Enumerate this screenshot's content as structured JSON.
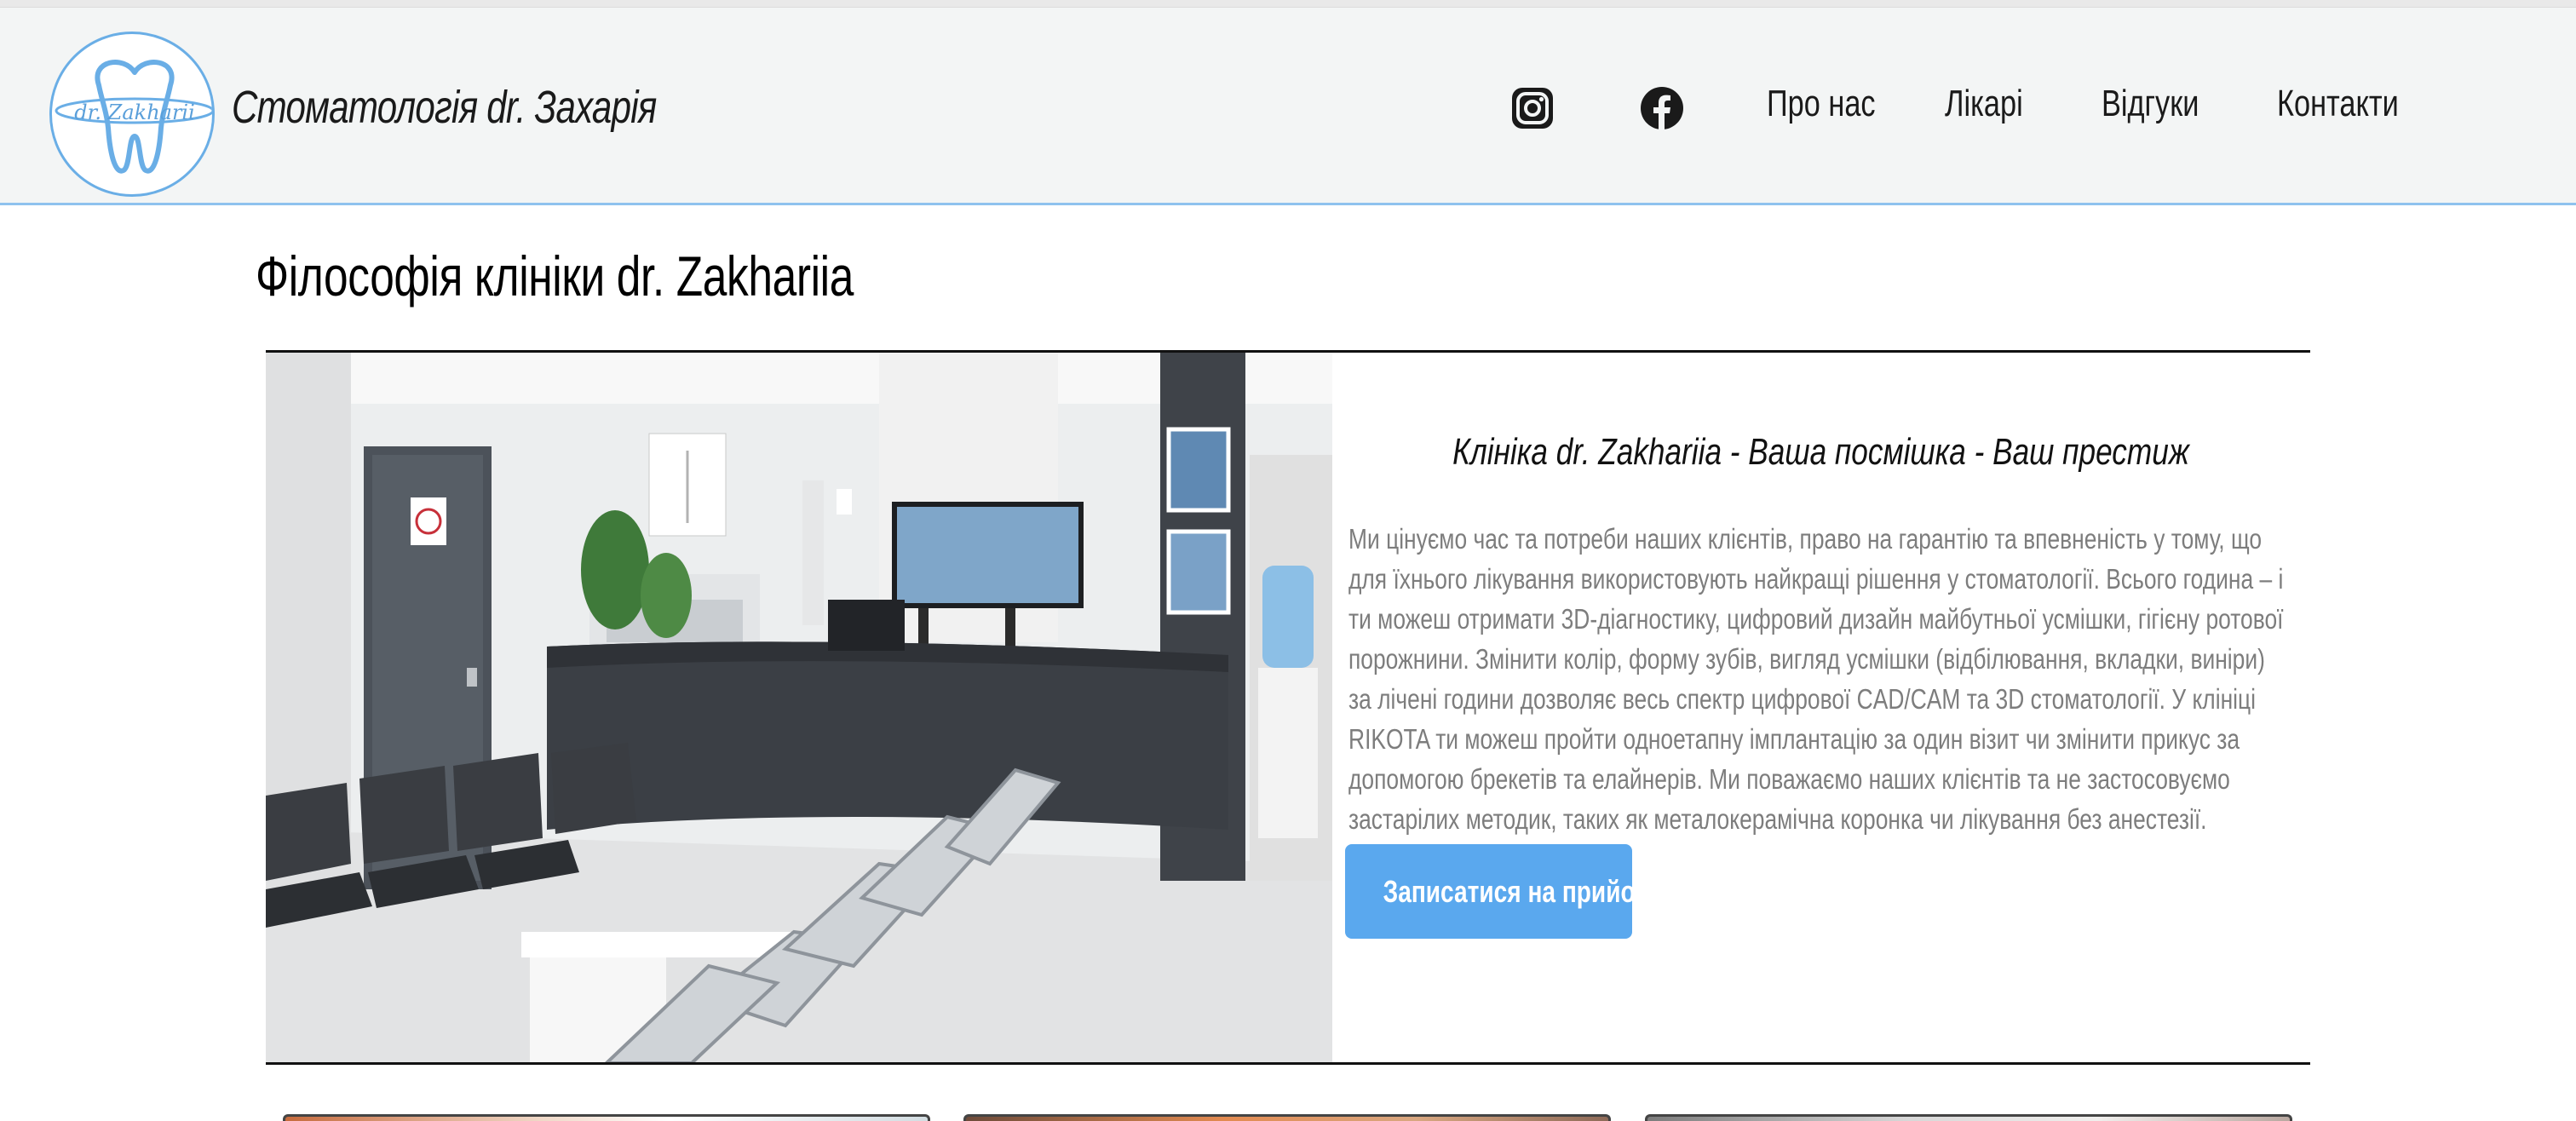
{
  "header": {
    "brand_name": "Стоматологія dr. Захарія",
    "logo_text": "dr. Zakharii",
    "social": [
      {
        "name": "instagram-icon"
      },
      {
        "name": "facebook-icon"
      }
    ],
    "nav": [
      {
        "label": "Про нас"
      },
      {
        "label": "Лікарі"
      },
      {
        "label": "Відгуки"
      },
      {
        "label": "Контакти"
      }
    ]
  },
  "main": {
    "section_title": "Філософія клініки dr. Zakhariia",
    "subtitle": "Клініка dr. Zakhariia - Ваша посмішка - Ваш престиж",
    "paragraph": "Ми цінуємо час та потреби наших клієнтів, право на гарантію та впевненість у тому, що для їхнього лікування використовують найкращі рішення у стоматології. Всього година – і ти можеш отримати 3D-діагностику, цифровий дизайн майбутньої усмішки, гігієну ротової порожнини. Змінити колір, форму зубів, вигляд усмішки (відбілювання, вкладки, виніри) за лічені години дозволяє весь спектр цифрової CAD/CAM та 3D стоматології. У клініці RIKOTA ти можеш пройти одноетапну імплантацію за один візит чи змінити прикус за допомогою брекетів та елайнерів. Ми поважаємо наших клієнтів та не застосовуємо застарілих методик, таких як металокерамічна коронка чи лікування без анестезії.",
    "cta_label": "Записатися на прийом"
  },
  "colors": {
    "accent": "#5aa8ee",
    "header_bg": "#f3f5f5",
    "header_border": "#8ec2ee",
    "text_muted": "#7d7d7d"
  }
}
